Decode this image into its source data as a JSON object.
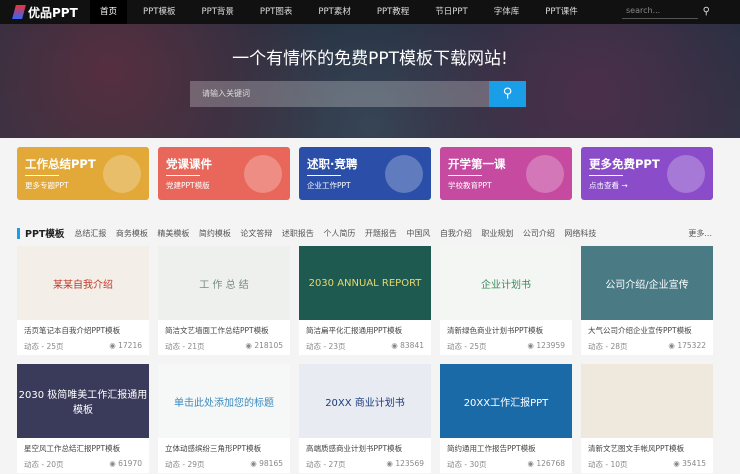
{
  "nav": {
    "logo": "优品PPT",
    "items": [
      "首页",
      "PPT模板",
      "PPT背景",
      "PPT图表",
      "PPT素材",
      "PPT教程",
      "节日PPT",
      "字体库",
      "PPT课件"
    ],
    "search_placeholder": "search..."
  },
  "hero": {
    "title": "一个有情怀的免费PPT模板下载网站!",
    "search_placeholder": "请输入关键词"
  },
  "banners": [
    {
      "title": "工作总结PPT",
      "sub": "更多专题PPT",
      "color": "#e2a838"
    },
    {
      "title": "党课课件",
      "sub": "党建PPT模版",
      "color": "#e8675a"
    },
    {
      "title": "述职·竞聘",
      "sub": "企业工作PPT",
      "color": "#2b4fa8"
    },
    {
      "title": "开学第一课",
      "sub": "学校教育PPT",
      "color": "#c64aa0"
    },
    {
      "title": "更多免费PPT",
      "sub": "点击查看 →",
      "color": "#8a4cc8"
    }
  ],
  "categories": {
    "title": "PPT模板",
    "items": [
      "总结汇报",
      "商务模板",
      "精美模板",
      "简约模板",
      "论文答辩",
      "述职报告",
      "个人简历",
      "开题报告",
      "中国风",
      "自我介绍",
      "职业规划",
      "公司介绍",
      "网络科技"
    ],
    "more": "更多..."
  },
  "cards": [
    {
      "thumb": "某某自我介绍",
      "title": "活页笔记本自我介绍PPT模板",
      "pages": "动态 - 25页",
      "views": "17216",
      "bg": "#f3efe8",
      "fg": "#c0392b"
    },
    {
      "thumb": "工 作 总 结",
      "title": "简洁文艺墙面工作总结PPT模板",
      "pages": "动态 - 21页",
      "views": "218105",
      "bg": "#eef0ee",
      "fg": "#7a8a80"
    },
    {
      "thumb": "2030 ANNUAL REPORT",
      "title": "简洁扁平化汇报通用PPT模板",
      "pages": "动态 - 23页",
      "views": "83841",
      "bg": "#1f5a50",
      "fg": "#e8d870"
    },
    {
      "thumb": "企业计划书",
      "title": "清新绿色商业计划书PPT模板",
      "pages": "动态 - 25页",
      "views": "123959",
      "bg": "#f4f6f4",
      "fg": "#3a8a5a"
    },
    {
      "thumb": "公司介绍/企业宣传",
      "title": "大气公司介绍企业宣传PPT模板",
      "pages": "动态 - 28页",
      "views": "175322",
      "bg": "#4a7a84",
      "fg": "#ffffff"
    },
    {
      "thumb": "2030 极简唯美工作汇报通用模板",
      "title": "星空风工作总结汇报PPT模板",
      "pages": "动态 - 20页",
      "views": "61970",
      "bg": "#3a3a5a",
      "fg": "#ffffff"
    },
    {
      "thumb": "单击此处添加您的标题",
      "title": "立体动感缤纷三角形PPT模板",
      "pages": "动态 - 29页",
      "views": "98165",
      "bg": "#f6f8f8",
      "fg": "#3a8ac0"
    },
    {
      "thumb": "20XX 商业计划书",
      "title": "高端质感商业计划书PPT模板",
      "pages": "动态 - 27页",
      "views": "123569",
      "bg": "#e8ecf2",
      "fg": "#1a3a7a"
    },
    {
      "thumb": "20XX工作汇报PPT",
      "title": "简约通用工作报告PPT模板",
      "pages": "动态 - 30页",
      "views": "126768",
      "bg": "#1a6aa8",
      "fg": "#ffffff"
    },
    {
      "thumb": "",
      "title": "清新文艺图文手帐风PPT模板",
      "pages": "动态 - 10页",
      "views": "35415",
      "bg": "#efe8dc",
      "fg": "#555555"
    }
  ]
}
